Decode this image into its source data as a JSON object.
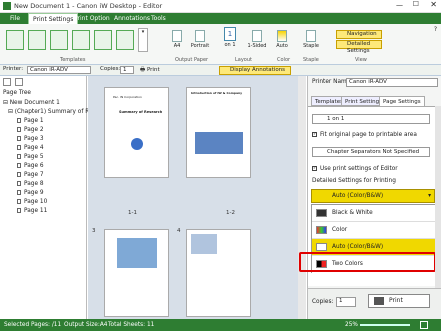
{
  "window": {
    "title": "New Document 1 - Canon iW Desktop - Editor"
  },
  "ribbon_tabs": [
    "File",
    "Print Settings",
    "Print Option",
    "Annotations",
    "Tools"
  ],
  "ribbon": {
    "templates_label": "Templates",
    "output_paper_label": "Output Paper",
    "layout_label": "Layout",
    "color_label": "Color",
    "staple_group_label": "Staple",
    "view_label": "View",
    "paper_size": "A4",
    "orientation": "Portrait",
    "pages_per_sheet": "1",
    "pages_per_sheet_label": "on 1",
    "sided": "1-Sided",
    "color_mode": "Auto",
    "staple": "Staple",
    "navigation": "Navigation",
    "detailed_settings": "Detailed Settings"
  },
  "toolbar": {
    "printer_label": "Printer:",
    "printer_value": "Canon iR-ADV",
    "copies_label": "Copies:",
    "copies_value": "1",
    "print_label": "Print",
    "display_annotations": "Display Annotations"
  },
  "page_tree": {
    "title": "Page Tree",
    "root": "New Document 1",
    "chapter": "(Chapter1) Summary of R...",
    "pages": [
      "Page 1",
      "Page 2",
      "Page 3",
      "Page 4",
      "Page 5",
      "Page 6",
      "Page 7",
      "Page 8",
      "Page 9",
      "Page 10",
      "Page 11"
    ]
  },
  "thumbnails": {
    "p1_title": "Summary of Research",
    "p1_corp": "Pac. IN Corporation",
    "p2_title": "Introduction of iW & Company",
    "labels": [
      "1-1",
      "1-2",
      "3",
      "4"
    ]
  },
  "right_panel": {
    "printer_name_label": "Printer Name:",
    "printer_name": "Canon iR-ADV",
    "tabs": [
      "Templates",
      "Print Settings",
      "Page Settings"
    ],
    "layout_value": "1 on 1",
    "fit_original": "Fit original page to printable area",
    "chapter_separators": "Chapter Separators Not Specified",
    "use_print_settings": "Use print settings of Editor",
    "detailed_heading": "Detailed Settings for Printing",
    "color_selected": "Auto (Color/B&W)",
    "color_options": [
      "Black & White",
      "Color",
      "Auto (Color/B&W)",
      "Two Colors"
    ],
    "copies_label": "Copies:",
    "copies_value": "1",
    "print_button": "Print"
  },
  "status": {
    "selected": "Selected Pages: /11",
    "output_size": "Output Size:A4",
    "total_sheets": "Total Sheets: 11",
    "zoom": "25%"
  },
  "colors": {
    "accent": "#2e7d32",
    "highlight": "#e00000",
    "auto_yellow": "#f0d800"
  }
}
